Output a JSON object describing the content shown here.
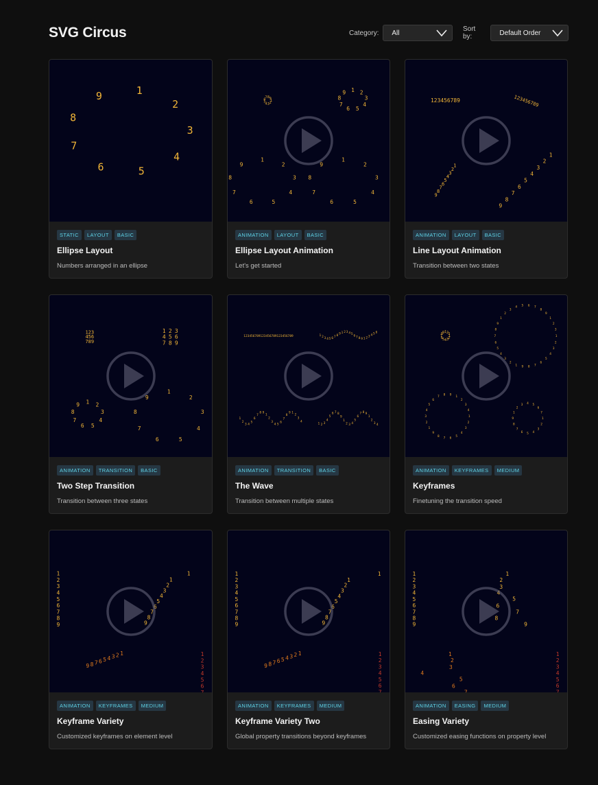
{
  "app": {
    "title": "SVG Circus"
  },
  "filters": {
    "category_label": "Category:",
    "category_value": "All",
    "sort_label": "Sort by:",
    "sort_value": "Default Order"
  },
  "colors": {
    "background": "#0f0f0f",
    "card": "#1c1c1c",
    "preview": "#03041a",
    "digit_gold": "#f1b537",
    "digit_orange": "#e07a1e",
    "digit_red": "#c73a2a",
    "tag_text": "#5fd4e8",
    "tag_bg": "#263743"
  },
  "icons": {
    "play": "play-icon",
    "chevron": "chevron-down-icon"
  },
  "cards": [
    {
      "tags": [
        "STATIC",
        "LAYOUT",
        "BASIC"
      ],
      "title": "Ellipse Layout",
      "description": "Numbers arranged in an ellipse",
      "has_play": false
    },
    {
      "tags": [
        "ANIMATION",
        "LAYOUT",
        "BASIC"
      ],
      "title": "Ellipse Layout Animation",
      "description": "Let's get started",
      "has_play": true
    },
    {
      "tags": [
        "ANIMATION",
        "LAYOUT",
        "BASIC"
      ],
      "title": "Line Layout Animation",
      "description": "Transition between two states",
      "has_play": true
    },
    {
      "tags": [
        "ANIMATION",
        "TRANSITION",
        "BASIC"
      ],
      "title": "Two Step Transition",
      "description": "Transition between three states",
      "has_play": true
    },
    {
      "tags": [
        "ANIMATION",
        "TRANSITION",
        "BASIC"
      ],
      "title": "The Wave",
      "description": "Transition between multiple states",
      "has_play": true
    },
    {
      "tags": [
        "ANIMATION",
        "KEYFRAMES",
        "MEDIUM"
      ],
      "title": "Keyframes",
      "description": "Finetuning the transition speed",
      "has_play": true
    },
    {
      "tags": [
        "ANIMATION",
        "KEYFRAMES",
        "MEDIUM"
      ],
      "title": "Keyframe Variety",
      "description": "Customized keyframes on element level",
      "has_play": true
    },
    {
      "tags": [
        "ANIMATION",
        "KEYFRAMES",
        "MEDIUM"
      ],
      "title": "Keyframe Variety Two",
      "description": "Global property transitions beyond keyframes",
      "has_play": true
    },
    {
      "tags": [
        "ANIMATION",
        "EASING",
        "MEDIUM"
      ],
      "title": "Easing Variety",
      "description": "Customized easing functions on property level",
      "has_play": true
    }
  ]
}
